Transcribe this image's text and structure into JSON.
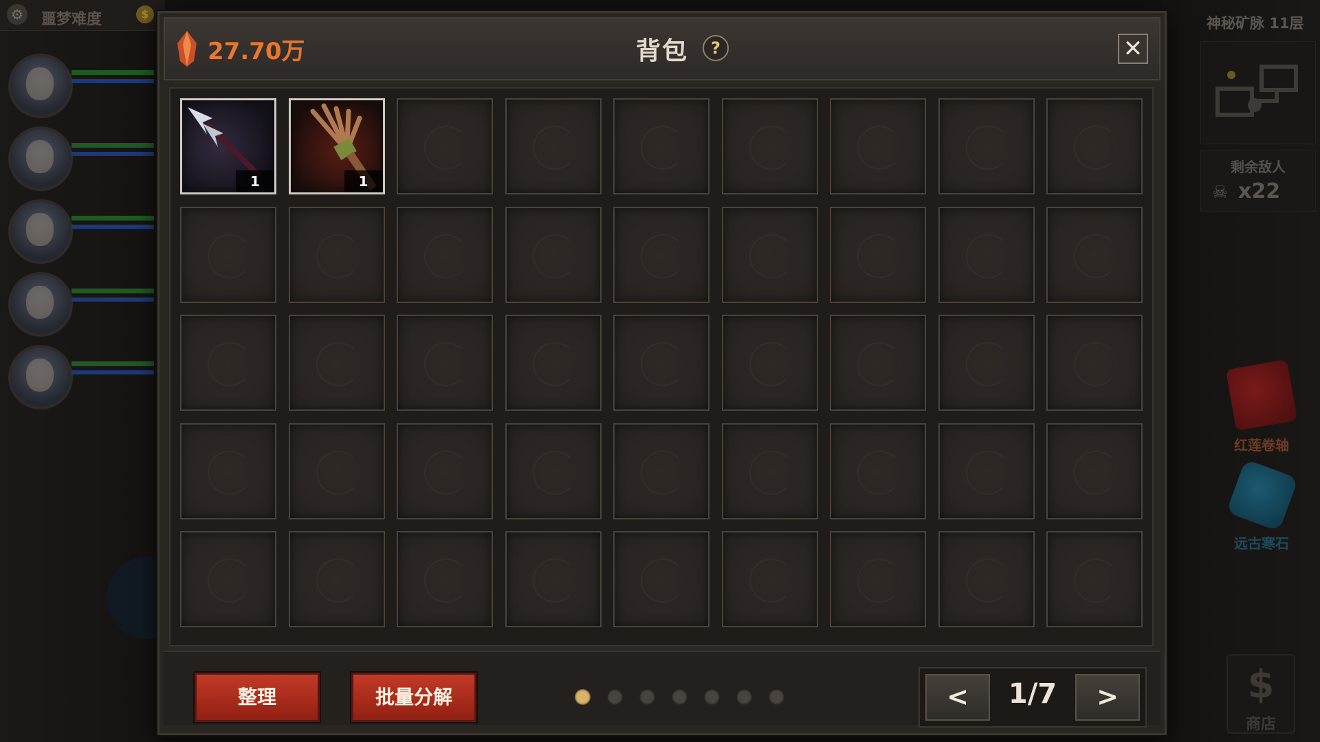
{
  "hud": {
    "difficulty": "噩梦难度",
    "location": "神秘矿脉 11层",
    "enemies_label": "剩余敌人",
    "enemies_count": "x22",
    "scroll_label": "红莲卷轴",
    "stone_label": "远古寒石",
    "shop_label": "商店",
    "shop_symbol": "$"
  },
  "inventory": {
    "title": "背包",
    "currency": "27.70万",
    "help": "?",
    "close": "✕",
    "slots": [
      {
        "item": "spear-item",
        "count": "1"
      },
      {
        "item": "broom-item",
        "count": "1"
      },
      {},
      {},
      {},
      {},
      {},
      {},
      {},
      {},
      {},
      {},
      {},
      {},
      {},
      {},
      {},
      {},
      {},
      {},
      {},
      {},
      {},
      {},
      {},
      {},
      {},
      {},
      {},
      {},
      {},
      {},
      {},
      {},
      {},
      {},
      {},
      {},
      {},
      {},
      {},
      {},
      {},
      {},
      {}
    ]
  },
  "footer": {
    "sort_label": "整理",
    "decompose_label": "批量分解",
    "page_text": "1/7",
    "current_page": 1,
    "total_pages": 7,
    "prev": "<",
    "next": ">"
  },
  "colors": {
    "currency": "#e7782e",
    "button_red": "#c23a28",
    "active_dot": "#d8b46a"
  }
}
